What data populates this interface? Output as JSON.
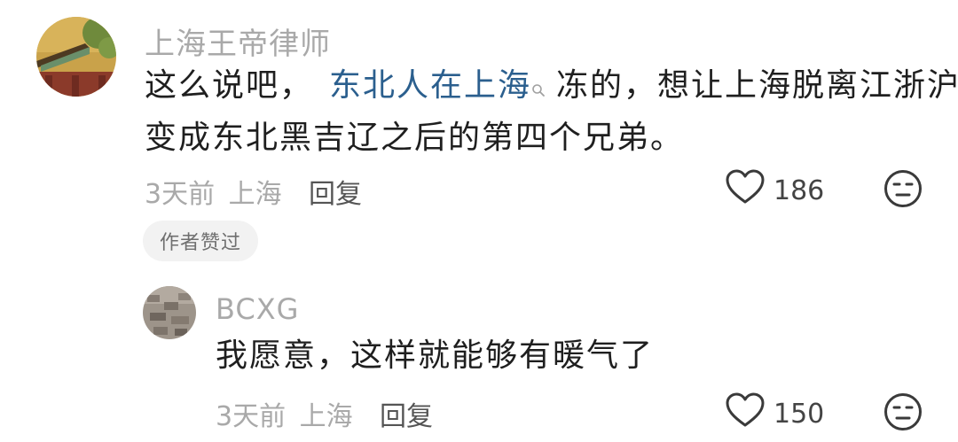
{
  "comment": {
    "author": "上海王帝律师",
    "text_before": "这么说吧，",
    "link_text": "东北人在上海",
    "text_after": "冻的，想让上海脱离江浙沪，",
    "line2": "变成东北黑吉辽之后的第四个兄弟。",
    "time": "3天前",
    "location": "上海",
    "reply_label": "回复",
    "likes": "186",
    "badge": "作者赞过",
    "icons": [
      "search-icon",
      "heart-icon",
      "dislike-face-icon"
    ]
  },
  "reply": {
    "author": "BCXG",
    "text": "我愿意，这样就能够有暖气了",
    "time": "3天前",
    "location": "上海",
    "reply_label": "回复",
    "likes": "150",
    "icons": [
      "heart-icon",
      "dislike-face-icon"
    ]
  },
  "colors": {
    "username": "#a9a9a9",
    "text": "#1f1f1f",
    "link": "#2b5f8e",
    "badge_bg": "#f2f2f2"
  }
}
